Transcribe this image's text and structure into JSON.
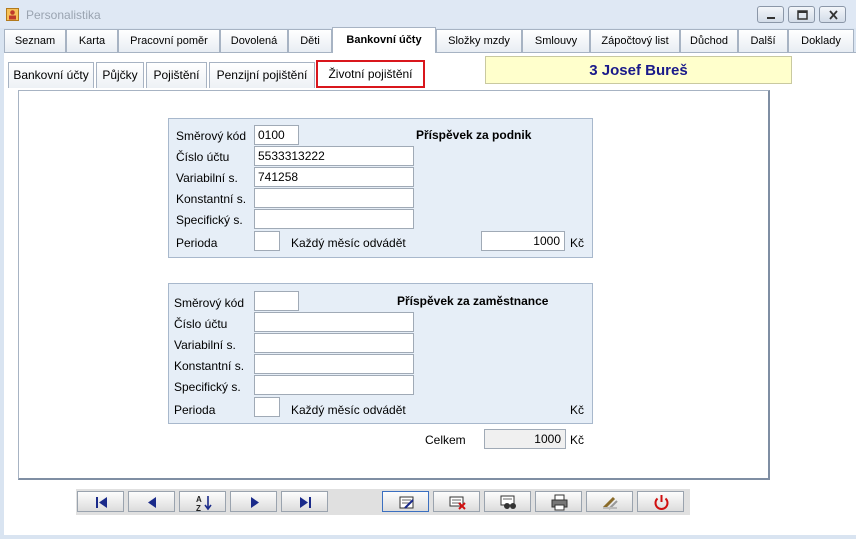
{
  "window": {
    "title": "Personalistika",
    "icons": [
      "app-icon",
      "minimize-icon",
      "maximize-icon",
      "close-icon"
    ]
  },
  "main_tabs": [
    "Seznam",
    "Karta",
    "Pracovní poměr",
    "Dovolená",
    "Děti",
    "Bankovní účty",
    "Složky mzdy",
    "Smlouvy",
    "Zápočtový list",
    "Důchod",
    "Další",
    "Doklady"
  ],
  "sub_tabs": [
    "Bankovní účty",
    "Půjčky",
    "Pojištění",
    "Penzijní pojištění",
    "Životní pojištění"
  ],
  "employee": "3 Josef Bureš",
  "group1": {
    "heading": "Příspěvek za podnik",
    "labels": {
      "smer": "Směrový kód",
      "cislo": "Číslo účtu",
      "var": "Variabilní s.",
      "konst": "Konstantní s.",
      "spec": "Specifický s.",
      "perioda": "Perioda",
      "kazdy": "Každý měsíc odvádět",
      "kc": "Kč"
    },
    "values": {
      "smer": "0100",
      "cislo": "5533313222",
      "var": "741258",
      "konst": "",
      "spec": "",
      "perioda": "",
      "amount": "1000"
    }
  },
  "group2": {
    "heading": "Příspěvek za zaměstnance",
    "labels": {
      "smer": "Směrový kód",
      "cislo": "Číslo účtu",
      "var": "Variabilní s.",
      "konst": "Konstantní s.",
      "spec": "Specifický s.",
      "perioda": "Perioda",
      "kazdy": "Každý měsíc odvádět",
      "kc": "Kč"
    },
    "values": {
      "smer": "",
      "cislo": "",
      "var": "",
      "konst": "",
      "spec": "",
      "perioda": ""
    }
  },
  "total": {
    "label": "Celkem",
    "value": "1000",
    "unit": "Kč"
  },
  "toolbar_icons": [
    "first-record-icon",
    "previous-record-icon",
    "sort-icon",
    "next-record-icon",
    "last-record-icon",
    "edit-icon",
    "delete-icon",
    "search-icon",
    "print-icon",
    "tools-icon",
    "power-icon"
  ],
  "colors": {
    "active_tab_border": "#d9161c",
    "employee_bg": "#ffffcc",
    "employee_text": "#1a1a8a",
    "group_bg": "#e6eef7"
  }
}
